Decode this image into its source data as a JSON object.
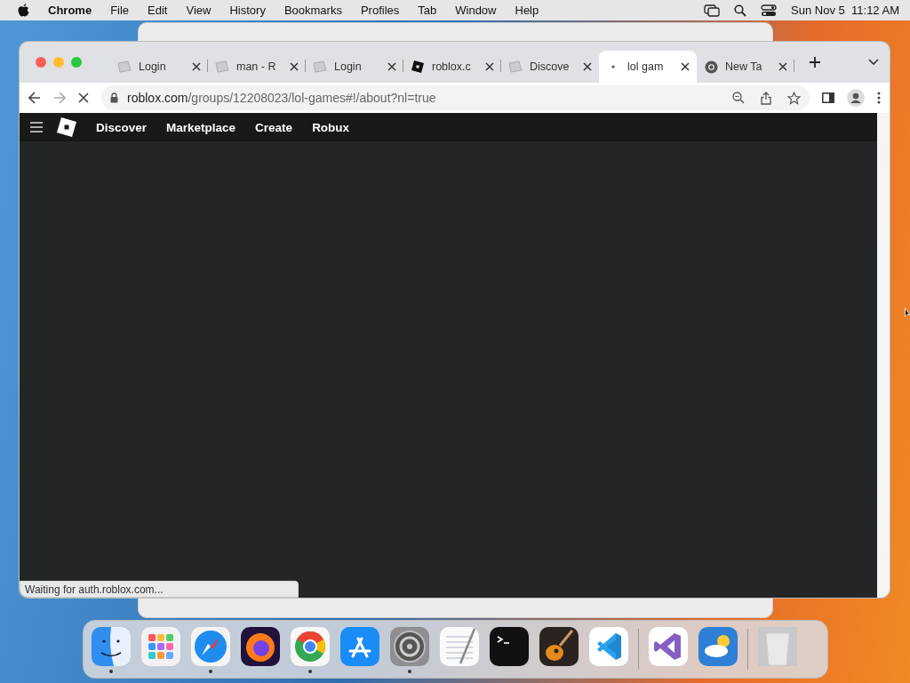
{
  "menu_bar": {
    "app_name": "Chrome",
    "menus": [
      "File",
      "Edit",
      "View",
      "History",
      "Bookmarks",
      "Profiles",
      "Tab",
      "Window",
      "Help"
    ],
    "clock": "Sun Nov 5  11:12 AM"
  },
  "browser": {
    "tabs": [
      {
        "title": "Login",
        "kind": "page",
        "selected": false
      },
      {
        "title": "man - R",
        "kind": "page",
        "selected": false
      },
      {
        "title": "Login",
        "kind": "page",
        "selected": false
      },
      {
        "title": "roblox.c",
        "kind": "roblox",
        "selected": false
      },
      {
        "title": "Discove",
        "kind": "page",
        "selected": false
      },
      {
        "title": "lol gam",
        "kind": "loading",
        "selected": true
      },
      {
        "title": "New Ta",
        "kind": "chrome",
        "selected": false
      }
    ],
    "url_host": "roblox.com",
    "url_path": "/groups/12208023/lol-games#!/about?nl=true",
    "loading": true,
    "site_nav": [
      "Discover",
      "Marketplace",
      "Create",
      "Robux"
    ],
    "status": "Waiting for auth.roblox.com..."
  },
  "dock": {
    "sections": [
      {
        "apps": [
          {
            "kind": "finder",
            "running": true
          },
          {
            "kind": "launchpad",
            "running": false
          },
          {
            "kind": "safari",
            "running": true
          },
          {
            "kind": "firefox",
            "running": false
          },
          {
            "kind": "chrome",
            "running": true
          },
          {
            "kind": "appstore",
            "running": false
          },
          {
            "kind": "settings",
            "running": true
          },
          {
            "kind": "textedit",
            "running": false
          },
          {
            "kind": "terminal",
            "running": false
          },
          {
            "kind": "guitar",
            "running": false
          },
          {
            "kind": "vscode",
            "running": false
          }
        ]
      },
      {
        "apps": [
          {
            "kind": "visualstudio",
            "running": false
          },
          {
            "kind": "weather",
            "running": false
          }
        ]
      },
      {
        "apps": [
          {
            "kind": "trash",
            "running": false
          }
        ]
      }
    ]
  }
}
